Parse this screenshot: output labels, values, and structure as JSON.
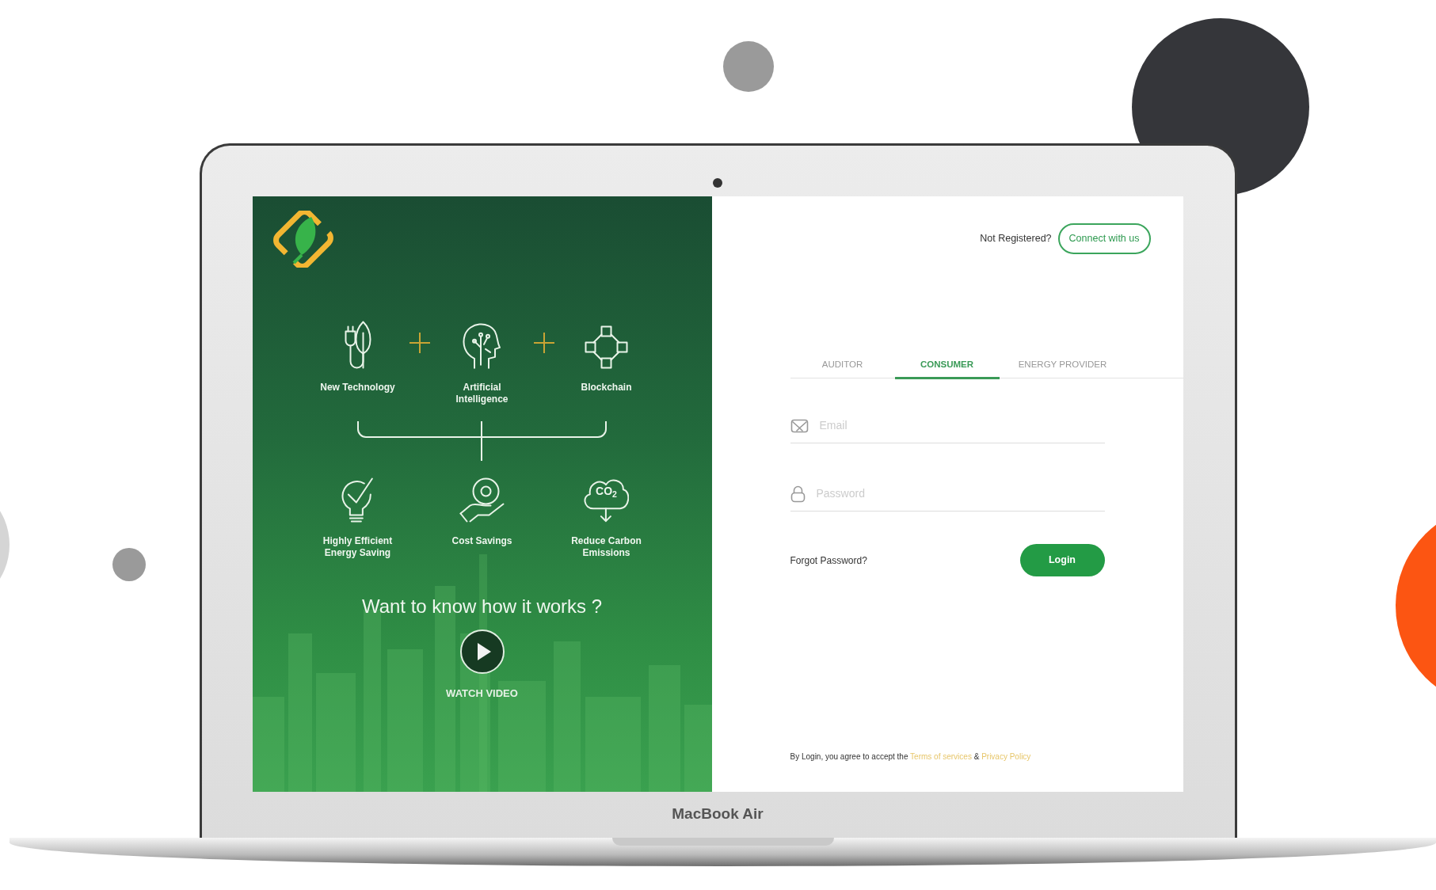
{
  "device": {
    "label": "MacBook Air"
  },
  "left_panel": {
    "top_features": [
      {
        "label": "New Technology"
      },
      {
        "label": "Artificial Intelligence"
      },
      {
        "label": "Blockchain"
      }
    ],
    "bottom_features": [
      {
        "label": "Highly Efficient Energy Saving"
      },
      {
        "label": "Cost Savings"
      },
      {
        "label": "Reduce Carbon Emissions",
        "icon_text": "CO$_{2}$"
      }
    ],
    "video_prompt": "Want to know how it works ?",
    "watch_video": "WATCH VIDEO"
  },
  "right_panel": {
    "not_registered": "Not Registered?",
    "connect_button": "Connect with us",
    "tabs": [
      {
        "label": "AUDITOR",
        "selected": false
      },
      {
        "label": "CONSUMER",
        "selected": true
      },
      {
        "label": "ENERGY PROVIDER",
        "selected": false
      }
    ],
    "email": {
      "placeholder": "Email"
    },
    "password": {
      "placeholder": "Password"
    },
    "forgot_password": "Forgot Password?",
    "login_button": "Login",
    "terms": {
      "text": "By Login, you agree to accept the",
      "terms_link": "Terms of services",
      "joiner": "&",
      "privacy_link": "Privacy Policy"
    }
  }
}
